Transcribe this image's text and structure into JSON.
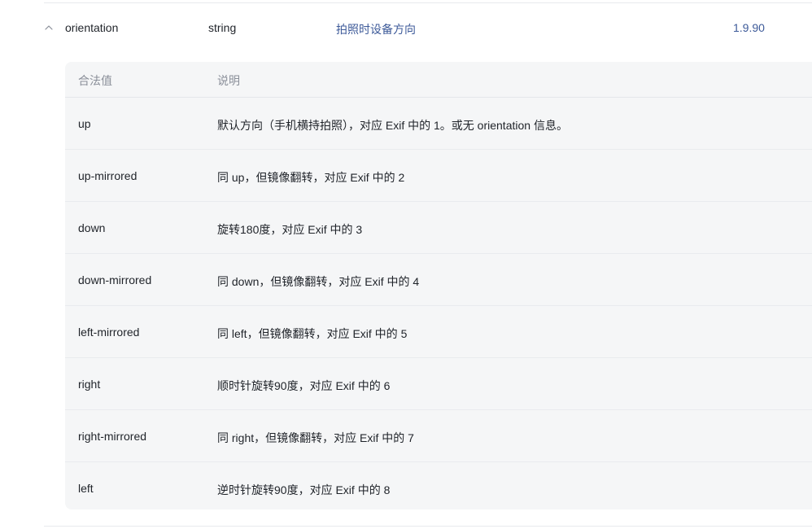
{
  "param": {
    "name": "orientation",
    "type": "string",
    "description": "拍照时设备方向",
    "version": "1.9.90"
  },
  "values_table": {
    "headers": [
      "合法值",
      "说明"
    ],
    "rows": [
      {
        "value": "up",
        "desc": "默认方向（手机横持拍照），对应 Exif 中的 1。或无 orientation 信息。"
      },
      {
        "value": "up-mirrored",
        "desc": "同 up，但镜像翻转，对应 Exif 中的 2"
      },
      {
        "value": "down",
        "desc": "旋转180度，对应 Exif 中的 3"
      },
      {
        "value": "down-mirrored",
        "desc": "同 down，但镜像翻转，对应 Exif 中的 4"
      },
      {
        "value": "left-mirrored",
        "desc": "同 left，但镜像翻转，对应 Exif 中的 5"
      },
      {
        "value": "right",
        "desc": "顺时针旋转90度，对应 Exif 中的 6"
      },
      {
        "value": "right-mirrored",
        "desc": "同 right，但镜像翻转，对应 Exif 中的 7"
      },
      {
        "value": "left",
        "desc": "逆时针旋转90度，对应 Exif 中的 8"
      }
    ]
  },
  "colors": {
    "link": "#3d5a99",
    "text": "#1f2329",
    "muted": "#8a8f99",
    "table_bg": "#f5f6f7"
  },
  "icons": {
    "toggle": "chevron-up-icon"
  }
}
